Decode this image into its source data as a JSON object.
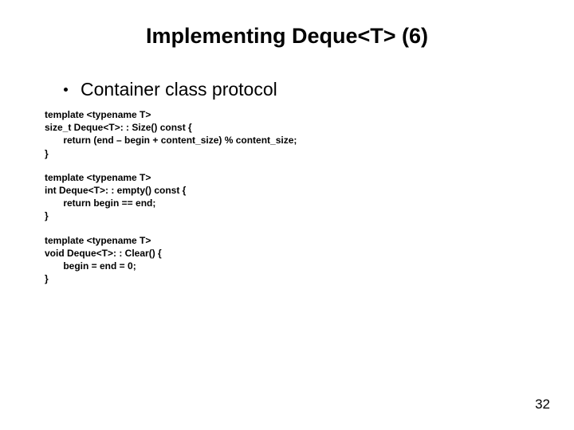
{
  "title": "Implementing Deque<T> (6)",
  "bullet": "Container class protocol",
  "code1": {
    "l0": "template <typename T>",
    "l1": "size_t Deque<T>: : Size() const {",
    "l2": "       return (end – begin + content_size) % content_size;",
    "l3": "}"
  },
  "code2": {
    "l0": "template <typename T>",
    "l1": "int Deque<T>: : empty() const {",
    "l2": "       return begin == end;",
    "l3": "}"
  },
  "code3": {
    "l0": "template <typename T>",
    "l1": "void Deque<T>: : Clear() {",
    "l2": "       begin = end = 0;",
    "l3": "}"
  },
  "pageNumber": "32"
}
